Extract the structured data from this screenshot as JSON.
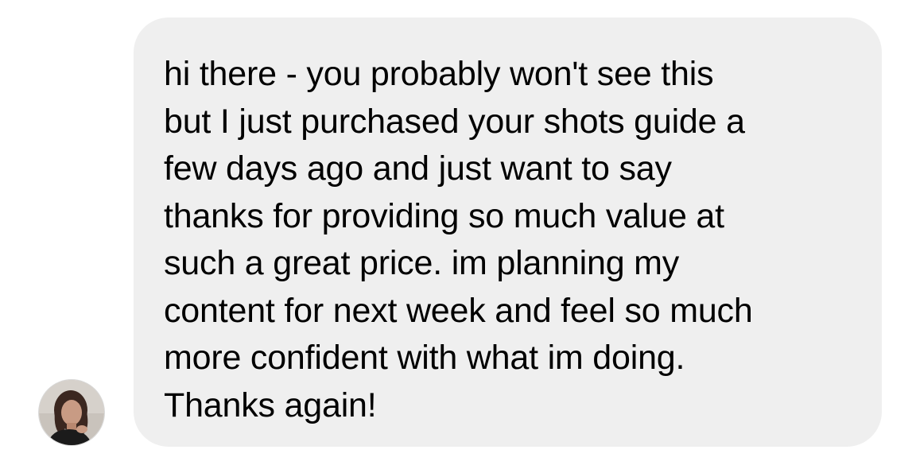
{
  "message": {
    "sender_avatar_icon": "person-photo-icon",
    "bubble_color": "#efefef",
    "text": "hi there - you probably won't see this\nbut I just purchased your shots guide a\nfew days ago and just want to say\nthanks for providing so much value at\nsuch a great price. im planning my\ncontent for next week and feel so much\nmore confident with what im doing.\nThanks again!"
  }
}
